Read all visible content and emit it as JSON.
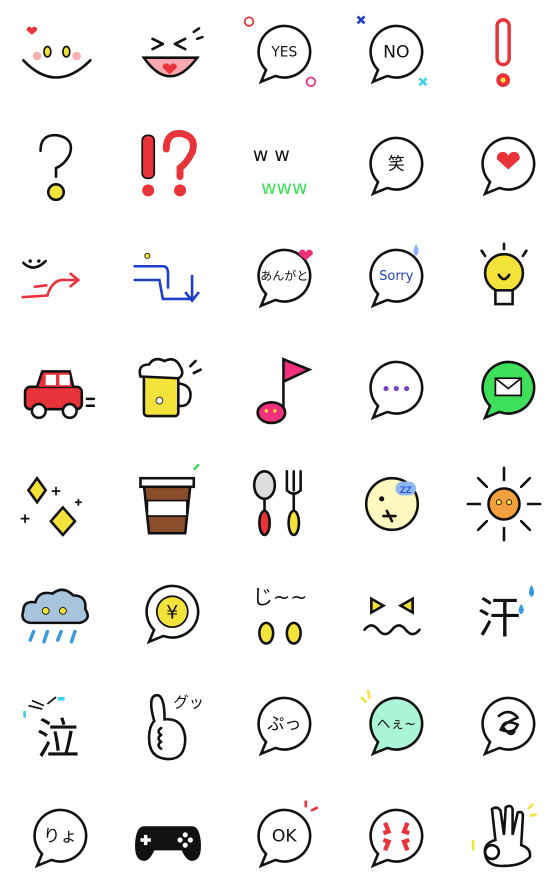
{
  "colors": {
    "outline": "#111111",
    "red": "#e8333a",
    "yellow": "#f2e23a",
    "blue": "#1f3fc4",
    "green": "#3ee05a",
    "pink": "#f0307a",
    "mint": "#aaf5d8",
    "purple": "#7a3fc4",
    "light_blue": "#8fb8f0"
  },
  "stickers": [
    {
      "icon": "smiling-face"
    },
    {
      "icon": "laughing-mouth"
    },
    {
      "icon": "bubble",
      "text": "YES",
      "deco": "circles"
    },
    {
      "icon": "bubble",
      "text": "NO",
      "deco": "crosses"
    },
    {
      "icon": "exclamation"
    },
    {
      "icon": "question"
    },
    {
      "icon": "exclamation-question"
    },
    {
      "icon": "laugh-w",
      "text": "w w",
      "text2": "www"
    },
    {
      "icon": "bubble",
      "text": "笑"
    },
    {
      "icon": "bubble",
      "fill_icon": "heart"
    },
    {
      "icon": "smile-arrow"
    },
    {
      "icon": "sad-arrow"
    },
    {
      "icon": "bubble",
      "text": "あんがと",
      "deco": "heart"
    },
    {
      "icon": "bubble",
      "text": "Sorry",
      "text_color": "#1f3fc4",
      "deco": "sweat"
    },
    {
      "icon": "lightbulb"
    },
    {
      "icon": "car"
    },
    {
      "icon": "beer"
    },
    {
      "icon": "music-note"
    },
    {
      "icon": "bubble",
      "fill_icon": "dots"
    },
    {
      "icon": "bubble",
      "fill": "#3ee05a",
      "fill_icon": "mail"
    },
    {
      "icon": "sparkles"
    },
    {
      "icon": "coffee"
    },
    {
      "icon": "spoon-fork"
    },
    {
      "icon": "moon-sleep",
      "text": "zz"
    },
    {
      "icon": "sun"
    },
    {
      "icon": "rain-cloud"
    },
    {
      "icon": "bubble",
      "text": "¥",
      "fill_icon": "coin"
    },
    {
      "icon": "drool",
      "text": "じ~~"
    },
    {
      "icon": "annoyed-face"
    },
    {
      "icon": "sweat-kanji",
      "text": "汗"
    },
    {
      "icon": "cry-kanji",
      "text": "泣"
    },
    {
      "icon": "thumbs-up",
      "text": "グッ"
    },
    {
      "icon": "bubble",
      "text": "ぷっ"
    },
    {
      "icon": "bubble",
      "text": "へぇ~",
      "fill": "#aaf5d8",
      "deco": "spark"
    },
    {
      "icon": "bubble",
      "fill_icon": "scribble"
    },
    {
      "icon": "bubble",
      "text": "りょ"
    },
    {
      "icon": "game-controller"
    },
    {
      "icon": "bubble",
      "text": "OK",
      "deco": "red-lines"
    },
    {
      "icon": "bubble",
      "fill_icon": "anger"
    },
    {
      "icon": "ok-hand"
    }
  ]
}
